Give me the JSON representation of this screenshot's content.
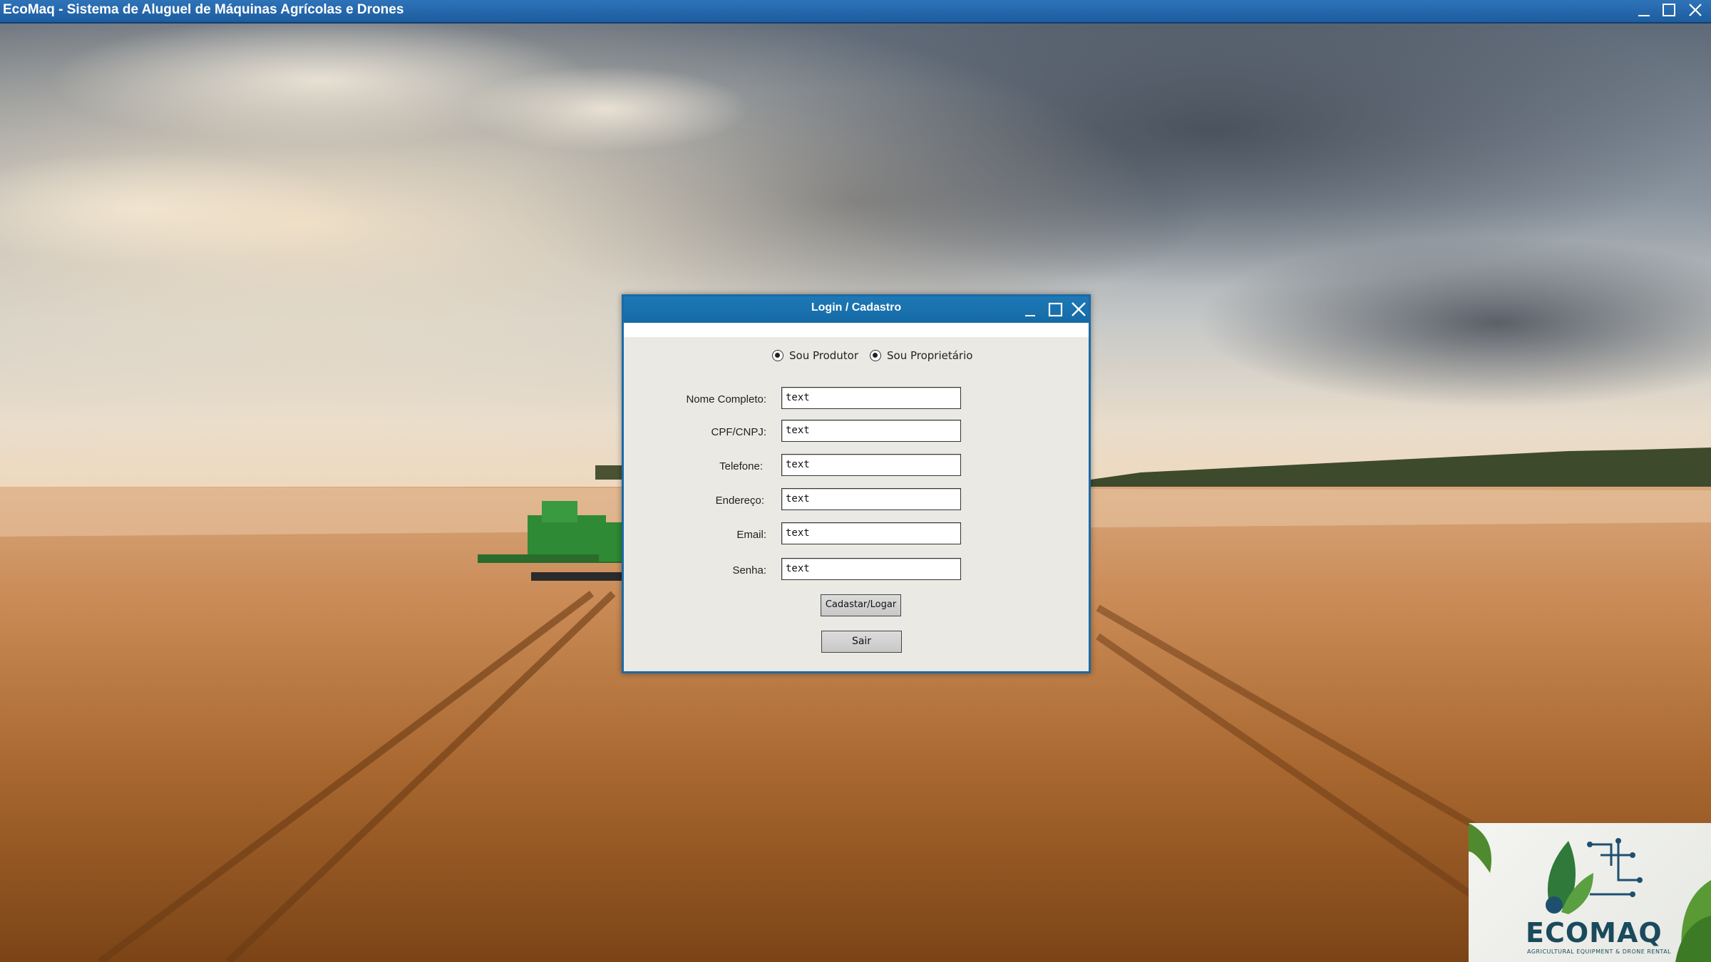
{
  "window": {
    "title": "EcoMaq - Sistema de Aluguel de Máquinas Agrícolas e Drones",
    "controls": [
      "minimize-icon",
      "maximize-icon",
      "close-icon"
    ]
  },
  "dialog": {
    "title": "Login / Cadastro",
    "controls": [
      "minimize-icon",
      "maximize-icon",
      "close-icon"
    ],
    "radios": [
      {
        "label": "Sou Produtor",
        "selected": true
      },
      {
        "label": "Sou Proprietário",
        "selected": true
      }
    ],
    "fields": [
      {
        "label": "Nome Completo:",
        "value": "text"
      },
      {
        "label": "CPF/CNPJ:",
        "value": "text"
      },
      {
        "label": "Telefone:",
        "value": "text"
      },
      {
        "label": "Endereço:",
        "value": "text"
      },
      {
        "label": "Email:",
        "value": "text"
      },
      {
        "label": "Senha:",
        "value": "text"
      }
    ],
    "buttons": {
      "submit": "Cadastar/Logar",
      "exit": "Sair"
    }
  },
  "logo": {
    "name": "ECOMAQ",
    "tagline": "AGRICULTURAL EQUIPMENT & DRONE RENTAL"
  },
  "colors": {
    "titlebar": "#1d5d9f",
    "dialog_titlebar": "#1a6aa6",
    "dialog_bg": "#ebe9e4",
    "logo_text": "#1a4a5c"
  }
}
